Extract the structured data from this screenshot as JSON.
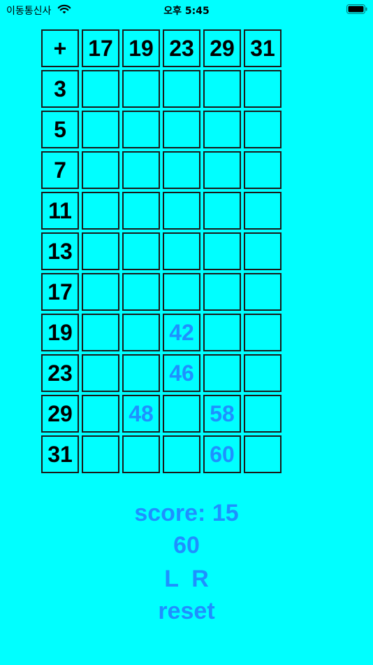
{
  "status_bar": {
    "carrier": "이동통신사",
    "time": "오후 5:45",
    "wifi_icon": "wifi-icon",
    "battery_icon": "battery-icon"
  },
  "grid": {
    "corner": "+",
    "columns": [
      "17",
      "19",
      "23",
      "29",
      "31"
    ],
    "rows": [
      "3",
      "5",
      "7",
      "11",
      "13",
      "17",
      "19",
      "23",
      "29",
      "31"
    ],
    "cells": [
      [
        "",
        "",
        "",
        "",
        ""
      ],
      [
        "",
        "",
        "",
        "",
        ""
      ],
      [
        "",
        "",
        "",
        "",
        ""
      ],
      [
        "",
        "",
        "",
        "",
        ""
      ],
      [
        "",
        "",
        "",
        "",
        ""
      ],
      [
        "",
        "",
        "",
        "",
        ""
      ],
      [
        "",
        "",
        "42",
        "",
        ""
      ],
      [
        "",
        "",
        "46",
        "",
        ""
      ],
      [
        "",
        "48",
        "",
        "58",
        ""
      ],
      [
        "",
        "",
        "",
        "60",
        ""
      ]
    ]
  },
  "score_label": "score: 15",
  "target": "60",
  "nav": "L  R",
  "reset_label": "reset",
  "colors": {
    "background": "#00FFFF",
    "accent": "#1E90FF",
    "grid_text": "#000000"
  }
}
